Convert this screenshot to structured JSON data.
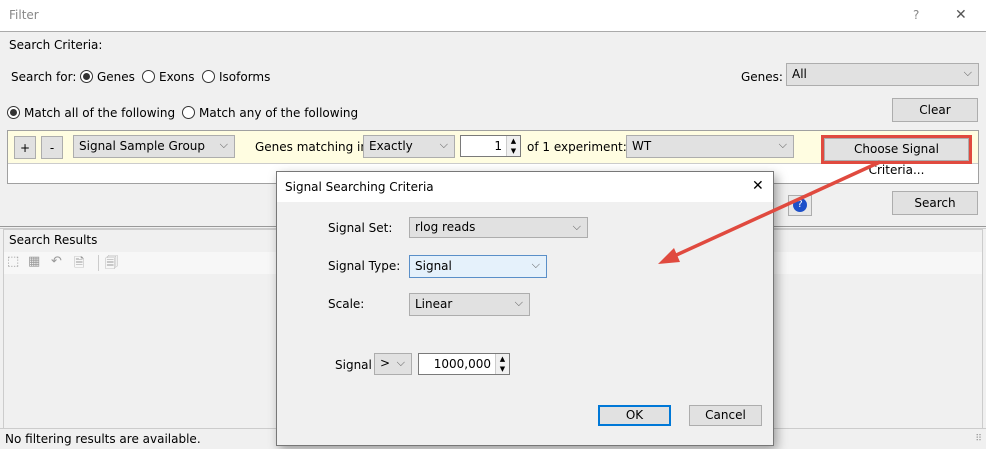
{
  "window": {
    "title": "Filter",
    "help": "?",
    "close": "✕"
  },
  "criteria": {
    "heading": "Search Criteria:",
    "search_for_label": "Search for:",
    "search_for_options": [
      "Genes",
      "Exons",
      "Isoforms"
    ],
    "genes_label": "Genes:",
    "genes_value": "All",
    "match_all": "Match all of the following",
    "match_any": "Match any of the following",
    "clear": "Clear",
    "row": {
      "add": "+",
      "remove": "-",
      "field": "Signal Sample Group",
      "matching_label": "Genes matching in",
      "mode": "Exactly",
      "count": "1",
      "of_label": "of 1 experiment:",
      "experiment": "WT",
      "choose": "Choose Signal Criteria..."
    },
    "search": "Search"
  },
  "results": {
    "heading": "Search Results",
    "status": "No filtering results are available."
  },
  "dialog": {
    "title": "Signal Searching Criteria",
    "close": "✕",
    "signal_set_label": "Signal Set:",
    "signal_set": "rlog reads",
    "signal_type_label": "Signal Type:",
    "signal_type": "Signal",
    "scale_label": "Scale:",
    "scale": "Linear",
    "signal_label": "Signal",
    "operator": ">",
    "value": "1000,000",
    "ok": "OK",
    "cancel": "Cancel"
  },
  "colors": {
    "highlight": "#e04a3f",
    "row_bg": "#fffde1",
    "focus": "#0078d7"
  }
}
